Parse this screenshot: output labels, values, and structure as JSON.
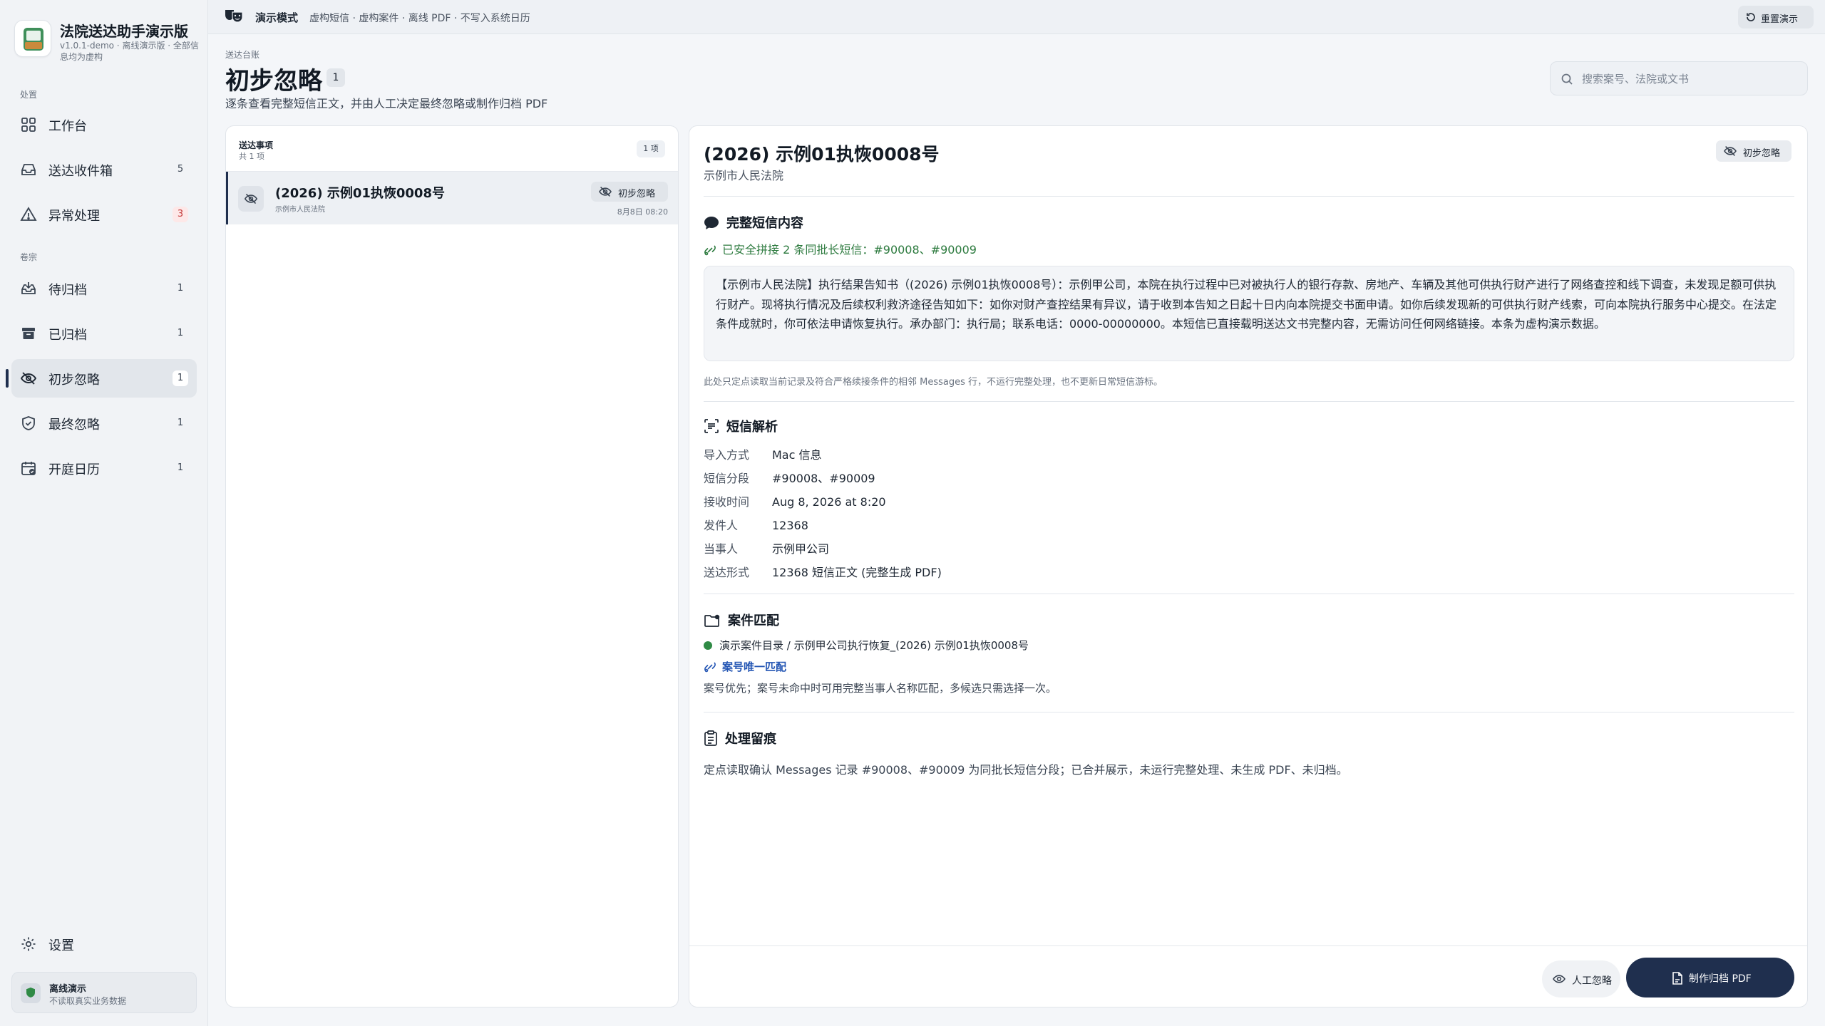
{
  "app": {
    "title": "法院送达助手演示版",
    "subtitle": "v1.0.1-demo · 离线演示版 · 全部信息均为虚构"
  },
  "sidebar": {
    "section_handle": "处置",
    "section_archive": "卷宗",
    "items": [
      {
        "label": "工作台",
        "count": "",
        "icon": "dashboard-grid-icon"
      },
      {
        "label": "送达收件箱",
        "count": "5",
        "icon": "inbox-icon"
      },
      {
        "label": "异常处理",
        "count": "3",
        "icon": "warning-triangle-icon"
      },
      {
        "label": "待归档",
        "count": "1",
        "icon": "inbox-download-icon"
      },
      {
        "label": "已归档",
        "count": "1",
        "icon": "archive-box-icon"
      },
      {
        "label": "初步忽略",
        "count": "1",
        "icon": "eye-off-icon"
      },
      {
        "label": "最终忽略",
        "count": "1",
        "icon": "shield-check-icon"
      },
      {
        "label": "开庭日历",
        "count": "1",
        "icon": "calendar-check-icon"
      }
    ],
    "settings_label": "设置",
    "offline": {
      "title": "离线演示",
      "subtitle": "不读取真实业务数据"
    }
  },
  "topbar": {
    "mode": "演示模式",
    "description": "虚构短信 · 虚构案件 · 离线 PDF · 不写入系统日历",
    "reset_label": "重置演示"
  },
  "header": {
    "breadcrumb": "送达台账",
    "title": "初步忽略",
    "count": "1",
    "description": "逐条查看完整短信正文，并由人工决定最终忽略或制作归档 PDF",
    "search_placeholder": "搜索案号、法院或文书"
  },
  "list": {
    "title": "送达事项",
    "subtitle": "共 1 项",
    "badge": "1 项",
    "rows": [
      {
        "case_no": "(2026) 示例01执恢0008号",
        "court": "示例市人民法院",
        "tag": "初步忽略",
        "time": "8月8日 08:20"
      }
    ]
  },
  "detail": {
    "case_no": "(2026) 示例01执恢0008号",
    "court": "示例市人民法院",
    "tag": "初步忽略",
    "sms_section": "完整短信内容",
    "merge_note": "已安全拼接 2 条同批长短信：#90008、#90009",
    "sms_body": "【示例市人民法院】执行结果告知书（(2026) 示例01执恢0008号）：示例甲公司，本院在执行过程中已对被执行人的银行存款、房地产、车辆及其他可供执行财产进行了网络查控和线下调查，未发现足额可供执行财产。现将执行情况及后续权利救济途径告知如下：如你对财产查控结果有异议，请于收到本告知之日起十日内向本院提交书面申请。如你后续发现新的可供执行财产线索，可向本院执行服务中心提交。在法定条件成就时，你可依法申请恢复执行。承办部门：执行局；联系电话：0000-00000000。本短信已直接载明送达文书完整内容，无需访问任何网络链接。本条为虚构演示数据。",
    "read_note": "此处只定点读取当前记录及符合严格续接条件的相邻 Messages 行，不运行完整处理，也不更新日常短信游标。",
    "parse_section": "短信解析",
    "fields": [
      {
        "key": "导入方式",
        "value": "Mac 信息"
      },
      {
        "key": "短信分段",
        "value": "#90008、#90009"
      },
      {
        "key": "接收时间",
        "value": "Aug 8, 2026 at 8:20"
      },
      {
        "key": "发件人",
        "value": "12368"
      },
      {
        "key": "当事人",
        "value": "示例甲公司"
      },
      {
        "key": "送达形式",
        "value": "12368 短信正文 (完整生成 PDF)"
      }
    ],
    "match_section": "案件匹配",
    "match_path": "演示案件目录 / 示例甲公司执行恢复_(2026) 示例01执恢0008号",
    "match_result": "案号唯一匹配",
    "match_note": "案号优先；案号未命中时可用完整当事人名称匹配，多候选只需选择一次。",
    "log_section": "处理留痕",
    "log_text": "定点读取确认 Messages 记录 #90008、#90009 为同批长短信分段；已合并展示，未运行完整处理、未生成 PDF、未归档。",
    "btn_ignore": "人工忽略",
    "btn_pdf": "制作归档 PDF"
  }
}
